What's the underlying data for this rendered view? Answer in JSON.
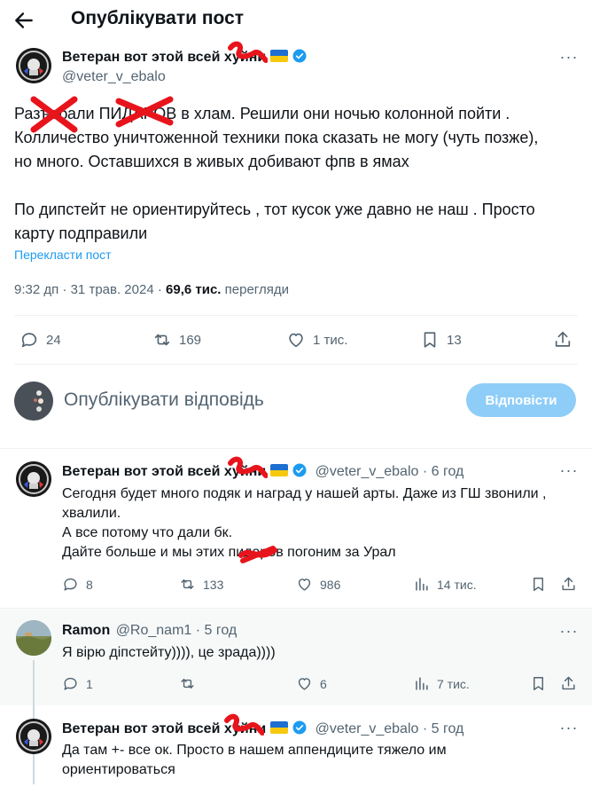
{
  "header": {
    "title": "Опублікувати пост"
  },
  "main_post": {
    "author_name": "Ветеран вот этой всей хуйни",
    "handle": "@veter_v_ebalo",
    "text_lines": [
      "Разъебали ПИДАРОВ в хлам. Решили они ночью колонной пойти .",
      "Колличество уничтоженной техники пока сказать не могу (чуть позже),",
      "но много. Оставшихся в живых добивают фпв в ямах"
    ],
    "text_lines_2": [
      "По дипстейт не ориентируйтесь , тот кусок уже давно не наш . Просто",
      "карту подправили"
    ],
    "translate_label": "Перекласти пост",
    "time": "9:32 дп",
    "dot": "·",
    "date": "31 трав. 2024",
    "views_count": "69,6 тис.",
    "views_label": "перегляди",
    "replies": "24",
    "reposts": "169",
    "likes": "1 тис.",
    "bookmarks": "13"
  },
  "composer": {
    "placeholder": "Опублікувати відповідь",
    "button_label": "Відповісти"
  },
  "replies": [
    {
      "author_name": "Ветеран вот этой всей хуйни",
      "handle": "@veter_v_ebalo",
      "time": "· 6 год",
      "lines": [
        "Сегодня будет много подяк и наград у нашей арты. Даже из ГШ звонили ,",
        "хвалили.",
        "А все потому что дали бк.",
        "Дайте больше и мы этих пидаров погоним за Урал"
      ],
      "replies": "8",
      "reposts": "133",
      "likes": "986",
      "views": "14 тис."
    },
    {
      "author_name": "Ramon",
      "handle": "@Ro_nam1",
      "time": "· 5 год",
      "lines": [
        "Я вірю діпстейту)))), це зрада))))"
      ],
      "replies": "1",
      "reposts": "",
      "likes": "6",
      "views": "7 тис."
    },
    {
      "author_name": "Ветеран вот этой всей хуйни",
      "handle": "@veter_v_ebalo",
      "time": "· 5 год",
      "lines": [
        "Да там +- все ок. Просто в нашем аппендиците тяжело им",
        "ориентироваться"
      ]
    }
  ],
  "colors": {
    "text": "#0f1419",
    "secondary": "#536471",
    "link": "#1d9bf0",
    "button_disabled": "#8ecdf8",
    "redaction": "#e8141c"
  },
  "icons": [
    "back-arrow-icon",
    "more-icon",
    "verified-icon",
    "reply-icon",
    "repost-icon",
    "like-icon",
    "bookmark-icon",
    "share-icon",
    "views-icon"
  ]
}
